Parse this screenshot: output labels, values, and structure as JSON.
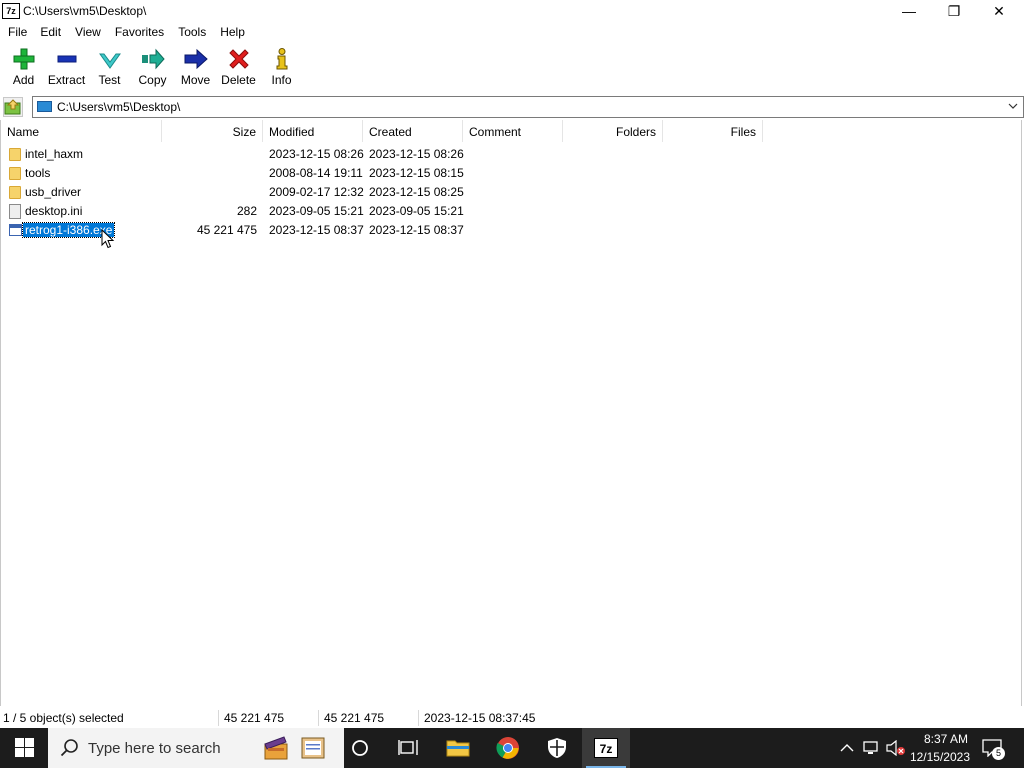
{
  "window": {
    "title": "C:\\Users\\vm5\\Desktop\\",
    "app_icon_label": "7z",
    "minimize_glyph": "—",
    "maximize_glyph": "❐",
    "close_glyph": "✕"
  },
  "menu": [
    "File",
    "Edit",
    "View",
    "Favorites",
    "Tools",
    "Help"
  ],
  "toolbar": [
    {
      "label": "Add",
      "icon": "plus-icon"
    },
    {
      "label": "Extract",
      "icon": "minus-icon"
    },
    {
      "label": "Test",
      "icon": "check-icon"
    },
    {
      "label": "Copy",
      "icon": "copy-arrow-icon"
    },
    {
      "label": "Move",
      "icon": "move-arrow-icon"
    },
    {
      "label": "Delete",
      "icon": "delete-x-icon"
    },
    {
      "label": "Info",
      "icon": "info-icon"
    }
  ],
  "address": {
    "path": "C:\\Users\\vm5\\Desktop\\"
  },
  "columns": [
    "Name",
    "Size",
    "Modified",
    "Created",
    "Comment",
    "Folders",
    "Files"
  ],
  "files": [
    {
      "name": "intel_haxm",
      "size": "",
      "modified": "2023-12-15 08:26",
      "created": "2023-12-15 08:26",
      "type": "folder"
    },
    {
      "name": "tools",
      "size": "",
      "modified": "2008-08-14 19:11",
      "created": "2023-12-15 08:15",
      "type": "folder"
    },
    {
      "name": "usb_driver",
      "size": "",
      "modified": "2009-02-17 12:32",
      "created": "2023-12-15 08:25",
      "type": "folder"
    },
    {
      "name": "desktop.ini",
      "size": "282",
      "modified": "2023-09-05 15:21",
      "created": "2023-09-05 15:21",
      "type": "file"
    },
    {
      "name": "retrog1-i386.exe",
      "size": "45 221 475",
      "modified": "2023-12-15 08:37",
      "created": "2023-12-15 08:37",
      "type": "exe",
      "selected": true
    }
  ],
  "status": {
    "selection": "1 / 5 object(s) selected",
    "size": "45 221 475",
    "packed": "45 221 475",
    "datetime": "2023-12-15 08:37:45"
  },
  "taskbar": {
    "search_placeholder": "Type here to search",
    "time": "8:37 AM",
    "date": "12/15/2023",
    "notification_count": "5",
    "apps": [
      "clapper-app-icon",
      "notepad-app-icon",
      "cortana-icon",
      "task-view-icon",
      "file-explorer-icon",
      "chrome-icon",
      "security-icon",
      "7zip-icon"
    ],
    "active_app": "7zip-icon",
    "seven_zip_label": "7z"
  }
}
